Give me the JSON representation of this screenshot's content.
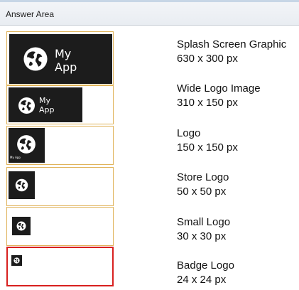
{
  "header": {
    "title": "Answer Area"
  },
  "logo_text": {
    "line1": "My",
    "line2": "App"
  },
  "items": [
    {
      "name": "Splash Screen Graphic",
      "size": "630 x 300 px"
    },
    {
      "name": "Wide Logo Image",
      "size": "310 x 150 px"
    },
    {
      "name": "Logo",
      "size": "150 x 150 px"
    },
    {
      "name": "Store Logo",
      "size": "50 x 50 px"
    },
    {
      "name": "Small Logo",
      "size": "30 x 30 px"
    },
    {
      "name": "Badge Logo",
      "size": "24 x 24 px"
    }
  ],
  "colors": {
    "tile_border": "#e0b35a",
    "selected_border": "#d8201f",
    "logo_bg": "#1c1c1c"
  }
}
